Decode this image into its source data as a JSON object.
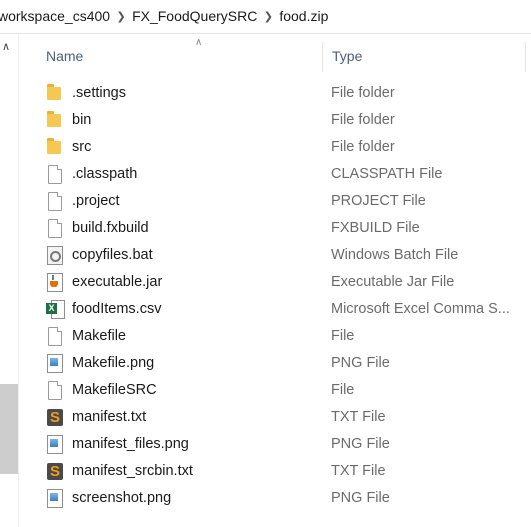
{
  "breadcrumb": [
    "workspace_cs400",
    "FX_FoodQuerySRC",
    "food.zip"
  ],
  "header": {
    "name_label": "Name",
    "type_label": "Type",
    "sorted_by": "name"
  },
  "files": [
    {
      "name": ".settings",
      "type": "File folder",
      "icon": "folder-icon"
    },
    {
      "name": "bin",
      "type": "File folder",
      "icon": "folder-icon"
    },
    {
      "name": "src",
      "type": "File folder",
      "icon": "folder-icon"
    },
    {
      "name": ".classpath",
      "type": "CLASSPATH File",
      "icon": "file-icon"
    },
    {
      "name": ".project",
      "type": "PROJECT File",
      "icon": "file-icon"
    },
    {
      "name": "build.fxbuild",
      "type": "FXBUILD File",
      "icon": "file-icon"
    },
    {
      "name": "copyfiles.bat",
      "type": "Windows Batch File",
      "icon": "batch-file-icon"
    },
    {
      "name": "executable.jar",
      "type": "Executable Jar File",
      "icon": "java-jar-icon"
    },
    {
      "name": "foodItems.csv",
      "type": "Microsoft Excel Comma S...",
      "icon": "excel-csv-icon"
    },
    {
      "name": "Makefile",
      "type": "File",
      "icon": "file-icon"
    },
    {
      "name": "Makefile.png",
      "type": "PNG File",
      "icon": "image-file-icon"
    },
    {
      "name": "MakefileSRC",
      "type": "File",
      "icon": "file-icon"
    },
    {
      "name": "manifest.txt",
      "type": "TXT File",
      "icon": "sublime-text-icon"
    },
    {
      "name": "manifest_files.png",
      "type": "PNG File",
      "icon": "image-file-icon"
    },
    {
      "name": "manifest_srcbin.txt",
      "type": "TXT File",
      "icon": "sublime-text-icon"
    },
    {
      "name": "screenshot.png",
      "type": "PNG File",
      "icon": "image-file-icon"
    }
  ],
  "colors": {
    "header_text": "#4c607a",
    "type_text": "#6b6b6b",
    "folder": "#f6c851"
  }
}
